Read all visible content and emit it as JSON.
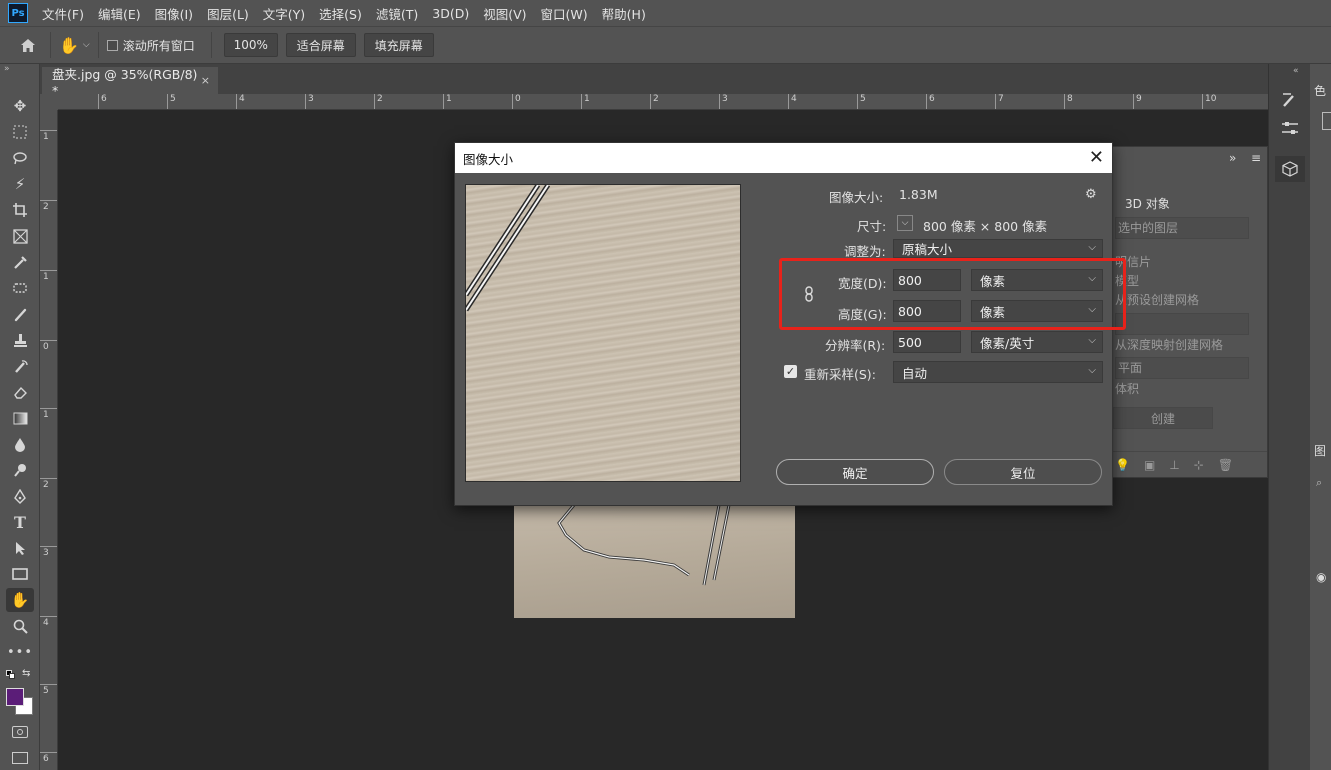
{
  "app": {
    "logo": "Ps",
    "menus": [
      "文件(F)",
      "编辑(E)",
      "图像(I)",
      "图层(L)",
      "文字(Y)",
      "选择(S)",
      "滤镜(T)",
      "3D(D)",
      "视图(V)",
      "窗口(W)",
      "帮助(H)"
    ]
  },
  "options": {
    "scroll_all_label": "滚动所有窗口",
    "zoom_value": "100%",
    "fit_screen": "适合屏幕",
    "fill_screen": "填充屏幕"
  },
  "document": {
    "tab_title": "盘夹.jpg @ 35%(RGB/8) *",
    "close": "×"
  },
  "rulers": {
    "h_labels": [
      "6",
      "5",
      "4",
      "3",
      "2",
      "1",
      "0",
      "1",
      "2",
      "3",
      "4",
      "5",
      "6",
      "7",
      "8",
      "9",
      "10"
    ],
    "v_labels": [
      "1",
      "2",
      "1",
      "0",
      "1",
      "2",
      "3",
      "4",
      "5",
      "6"
    ]
  },
  "panel_3d": {
    "title": "3D 对象",
    "source_select": "选中的图层",
    "options": [
      "明信片",
      "模型",
      "从预设创建网格"
    ],
    "depth_map": "从深度映射创建网格",
    "plane": "平面",
    "volume": "体积",
    "create_button": "创建"
  },
  "dialog": {
    "title": "图像大小",
    "close": "✕",
    "image_size_label": "图像大小:",
    "image_size_value": "1.83M",
    "dimensions_label": "尺寸:",
    "dimensions_value": "800 像素 × 800 像素",
    "fit_to_label": "调整为:",
    "fit_to_value": "原稿大小",
    "width_label": "宽度(D):",
    "width_value": "800",
    "width_unit": "像素",
    "height_label": "高度(G):",
    "height_value": "800",
    "height_unit": "像素",
    "resolution_label": "分辨率(R):",
    "resolution_value": "500",
    "resolution_unit": "像素/英寸",
    "resample_label": "重新采样(S):",
    "resample_value": "自动",
    "resample_checked": true,
    "ok_button": "确定",
    "reset_button": "复位"
  },
  "colors": {
    "foreground": "#5b1d78",
    "background": "#ffffff",
    "highlight": "#e8221a"
  }
}
